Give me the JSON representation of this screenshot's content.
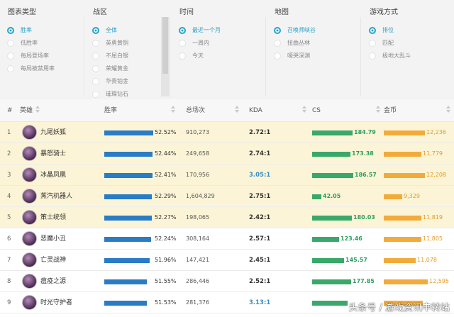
{
  "filters": {
    "columns": [
      {
        "title": "图表类型",
        "options": [
          "胜率",
          "低胜率",
          "每局登场率",
          "每局被禁用率"
        ],
        "selected": 0
      },
      {
        "title": "战区",
        "options": [
          "全体",
          "英勇黄铜",
          "不屈白银",
          "荣耀黄金",
          "华贵铂金",
          "璀璨钻石"
        ],
        "selected": 0
      },
      {
        "title": "时间",
        "options": [
          "最近一个月",
          "一周内",
          "今天"
        ],
        "selected": 0
      },
      {
        "title": "地图",
        "options": [
          "召唤师峡谷",
          "扭曲丛林",
          "嚎哭深渊"
        ],
        "selected": 0
      },
      {
        "title": "游戏方式",
        "options": [
          "排位",
          "匹配",
          "极地大乱斗"
        ],
        "selected": 0
      }
    ]
  },
  "table": {
    "headers": {
      "rank": "#",
      "hero": "英雄",
      "winrate": "胜率",
      "games": "总场次",
      "kda": "KDA",
      "cs": "CS",
      "gold": "金币"
    },
    "rows": [
      {
        "rank": "1",
        "name": "九尾妖狐",
        "winrate": "52.52%",
        "winrate_value": 52.52,
        "games": "910,273",
        "kda": "2.72:1",
        "kda_blue": false,
        "cs": "184.79",
        "cs_value": 184.79,
        "gold": "12,236",
        "gold_value": 12236,
        "highlight": true
      },
      {
        "rank": "2",
        "name": "暴怒骑士",
        "winrate": "52.44%",
        "winrate_value": 52.44,
        "games": "249,658",
        "kda": "2.74:1",
        "kda_blue": false,
        "cs": "173.38",
        "cs_value": 173.38,
        "gold": "11,779",
        "gold_value": 11779,
        "highlight": true
      },
      {
        "rank": "3",
        "name": "冰晶凤凰",
        "winrate": "52.41%",
        "winrate_value": 52.41,
        "games": "170,956",
        "kda": "3.05:1",
        "kda_blue": true,
        "cs": "186.57",
        "cs_value": 186.57,
        "gold": "12,208",
        "gold_value": 12208,
        "highlight": true
      },
      {
        "rank": "4",
        "name": "蒸汽机器人",
        "winrate": "52.29%",
        "winrate_value": 52.29,
        "games": "1,604,829",
        "kda": "2.75:1",
        "kda_blue": false,
        "cs": "42.05",
        "cs_value": 42.05,
        "gold": "9,329",
        "gold_value": 9329,
        "highlight": true
      },
      {
        "rank": "5",
        "name": "策士统领",
        "winrate": "52.27%",
        "winrate_value": 52.27,
        "games": "198,065",
        "kda": "2.42:1",
        "kda_blue": false,
        "cs": "180.03",
        "cs_value": 180.03,
        "gold": "11,819",
        "gold_value": 11819,
        "highlight": true
      },
      {
        "rank": "6",
        "name": "恶魔小丑",
        "winrate": "52.24%",
        "winrate_value": 52.24,
        "games": "308,164",
        "kda": "2.57:1",
        "kda_blue": false,
        "cs": "123.46",
        "cs_value": 123.46,
        "gold": "11,805",
        "gold_value": 11805,
        "highlight": false
      },
      {
        "rank": "7",
        "name": "亡灵战神",
        "winrate": "51.96%",
        "winrate_value": 51.96,
        "games": "147,421",
        "kda": "2.45:1",
        "kda_blue": false,
        "cs": "145.57",
        "cs_value": 145.57,
        "gold": "11,078",
        "gold_value": 11078,
        "highlight": false
      },
      {
        "rank": "8",
        "name": "瘟疫之源",
        "winrate": "51.55%",
        "winrate_value": 51.55,
        "games": "286,446",
        "kda": "2.52:1",
        "kda_blue": false,
        "cs": "177.85",
        "cs_value": 177.85,
        "gold": "12,595",
        "gold_value": 12595,
        "highlight": false
      },
      {
        "rank": "9",
        "name": "时光守护者",
        "winrate": "51.53%",
        "winrate_value": 51.53,
        "games": "281,376",
        "kda": "3.13:1",
        "kda_blue": true,
        "cs": "",
        "cs_value": 160,
        "gold": "",
        "gold_value": 12000,
        "highlight": false
      }
    ]
  },
  "watermark": "头条号 / 游戏资讯中转站",
  "colors": {
    "accent": "#29a3cc",
    "winrate_bar": "#2a7cc4",
    "cs_bar": "#39a86a",
    "gold_bar": "#f2ab3a",
    "highlight_row": "#fcf4d6"
  }
}
